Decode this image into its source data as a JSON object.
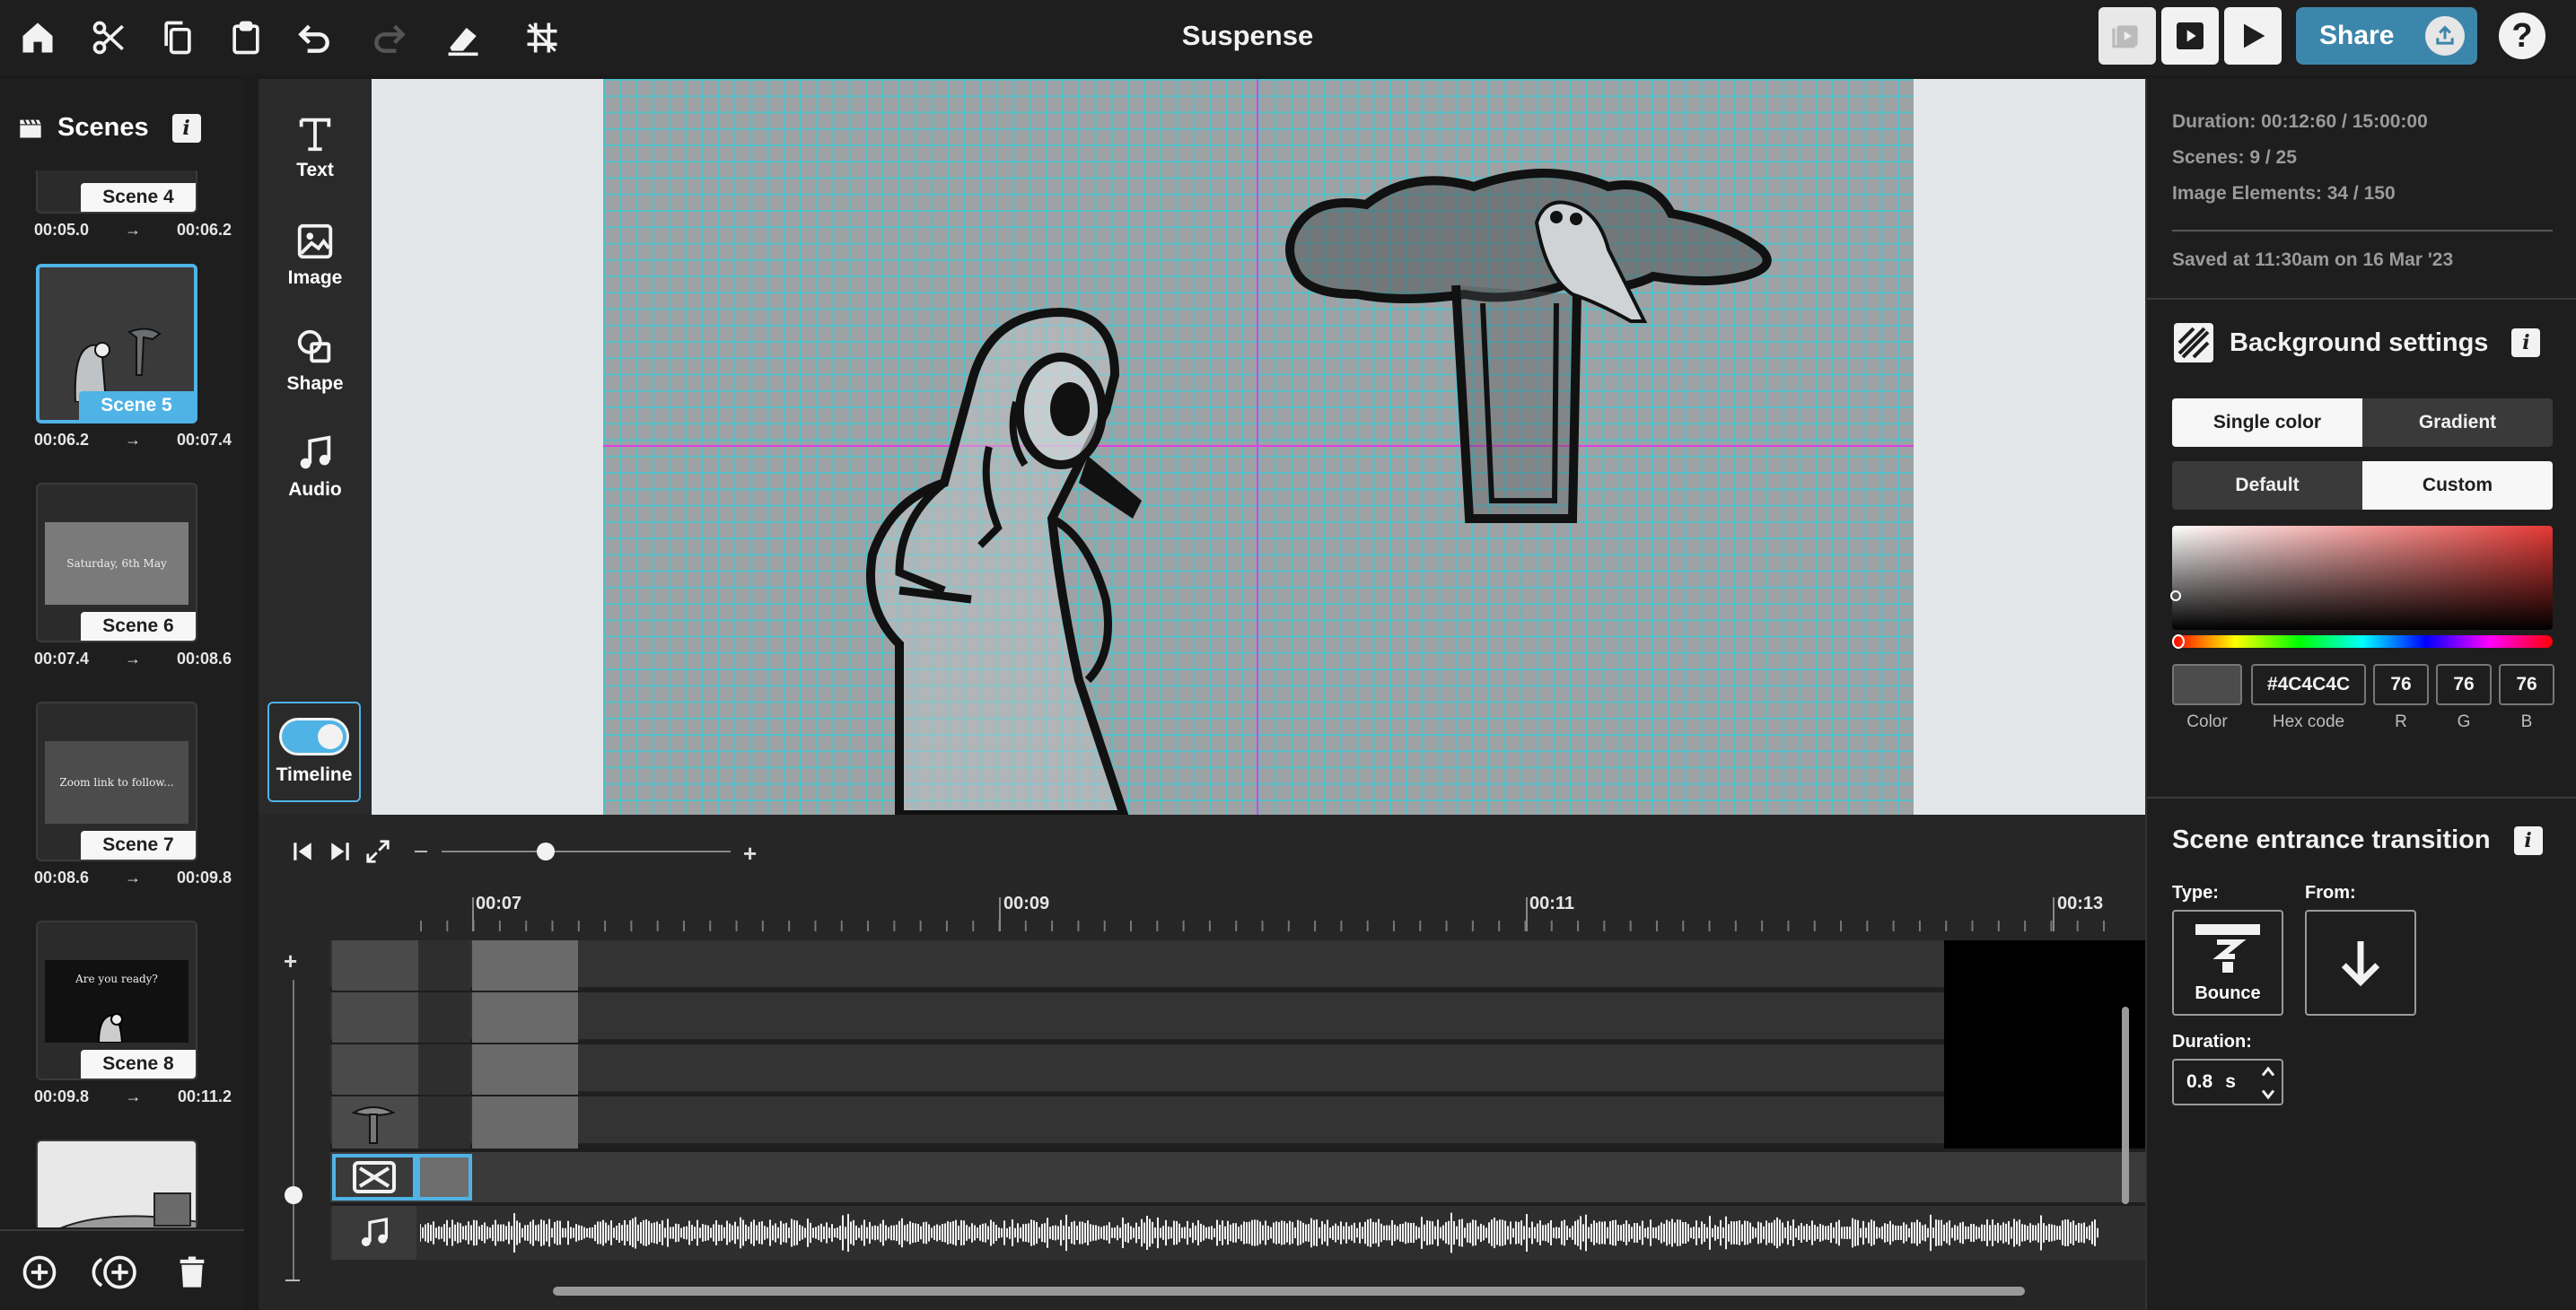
{
  "app": {
    "title": "Suspense",
    "share_label": "Share",
    "help_label": "?"
  },
  "toolbar_icons": [
    "home-icon",
    "scissors-icon",
    "copy-icon",
    "clipboard-icon",
    "undo-icon",
    "redo-icon",
    "eraser-icon",
    "grid-icon"
  ],
  "scenes_panel": {
    "heading": "Scenes",
    "info_label": "i",
    "items": [
      {
        "label": "Scene 4",
        "start": "00:05.0",
        "end": "00:06.2",
        "thumb_text": ""
      },
      {
        "label": "Scene 5",
        "start": "00:06.2",
        "end": "00:07.4",
        "thumb_text": "",
        "selected": true
      },
      {
        "label": "Scene 6",
        "start": "00:07.4",
        "end": "00:08.6",
        "thumb_text": "Saturday, 6th May"
      },
      {
        "label": "Scene 7",
        "start": "00:08.6",
        "end": "00:09.8",
        "thumb_text": "Zoom link to follow..."
      },
      {
        "label": "Scene 8",
        "start": "00:09.8",
        "end": "00:11.2",
        "thumb_text": "Are you ready?"
      }
    ],
    "arrow": "→"
  },
  "tools": {
    "text": "Text",
    "image": "Image",
    "shape": "Shape",
    "audio": "Audio",
    "timeline": "Timeline"
  },
  "timeline": {
    "ruler": [
      "00:07",
      "00:09",
      "00:11",
      "00:13"
    ],
    "zoom_level": 0.36
  },
  "info_panel": {
    "duration": "Duration: 00:12:60 / 15:00:00",
    "scenes": "Scenes: 9 / 25",
    "image_elements": "Image Elements: 34 / 150",
    "saved": "Saved at 11:30am on 16 Mar '23"
  },
  "background_settings": {
    "heading": "Background settings",
    "info_label": "i",
    "mode_tabs": [
      "Single color",
      "Gradient"
    ],
    "preset_tabs": [
      "Default",
      "Custom"
    ],
    "hex": "#4C4C4C",
    "r": "76",
    "g": "76",
    "b": "76",
    "labels": {
      "color": "Color",
      "hex": "Hex code",
      "r": "R",
      "g": "G",
      "b": "B"
    },
    "swatch_color": "#4c4c4c",
    "picker_hue": "#e53935"
  },
  "transition": {
    "heading": "Scene entrance transition",
    "info_label": "i",
    "type_label": "Type:",
    "from_label": "From:",
    "type_value": "Bounce",
    "duration_label": "Duration:",
    "duration_value": "0.8",
    "duration_unit": "s"
  },
  "colors": {
    "accent": "#4fb3e6",
    "share": "#3d86ab",
    "guide": "#e040e0"
  }
}
